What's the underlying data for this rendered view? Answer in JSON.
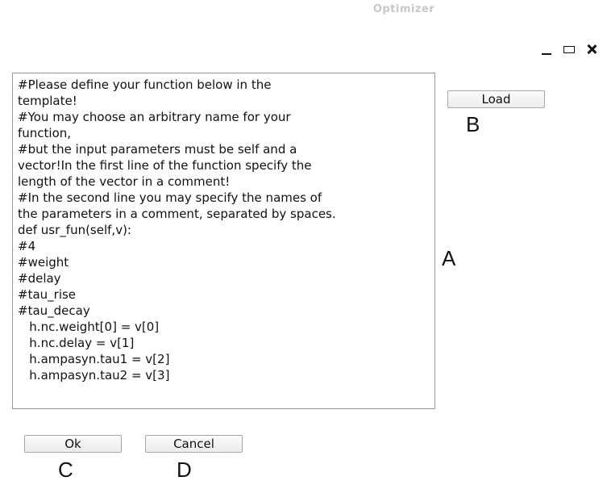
{
  "window": {
    "title": "Optimizer"
  },
  "editor": {
    "lines": [
      "#Please define your function below in the",
      "template!",
      "#You may choose an arbitrary name for your",
      "function,",
      "#but the input parameters must be self and a",
      "vector!In the first line of the function specify the",
      "length of the vector in a comment!",
      "#In the second line you may specify the names of",
      "the parameters in a comment, separated by spaces.",
      "def usr_fun(self,v):",
      "#4",
      "#weight",
      "#delay",
      "#tau_rise",
      "#tau_decay",
      "   h.nc.weight[0] = v[0]",
      "   h.nc.delay = v[1]",
      "   h.ampasyn.tau1 = v[2]",
      "   h.ampasyn.tau2 = v[3]"
    ]
  },
  "buttons": {
    "load": "Load",
    "ok": "Ok",
    "cancel": "Cancel"
  },
  "markers": {
    "a": "A",
    "b": "B",
    "c": "C",
    "d": "D"
  }
}
